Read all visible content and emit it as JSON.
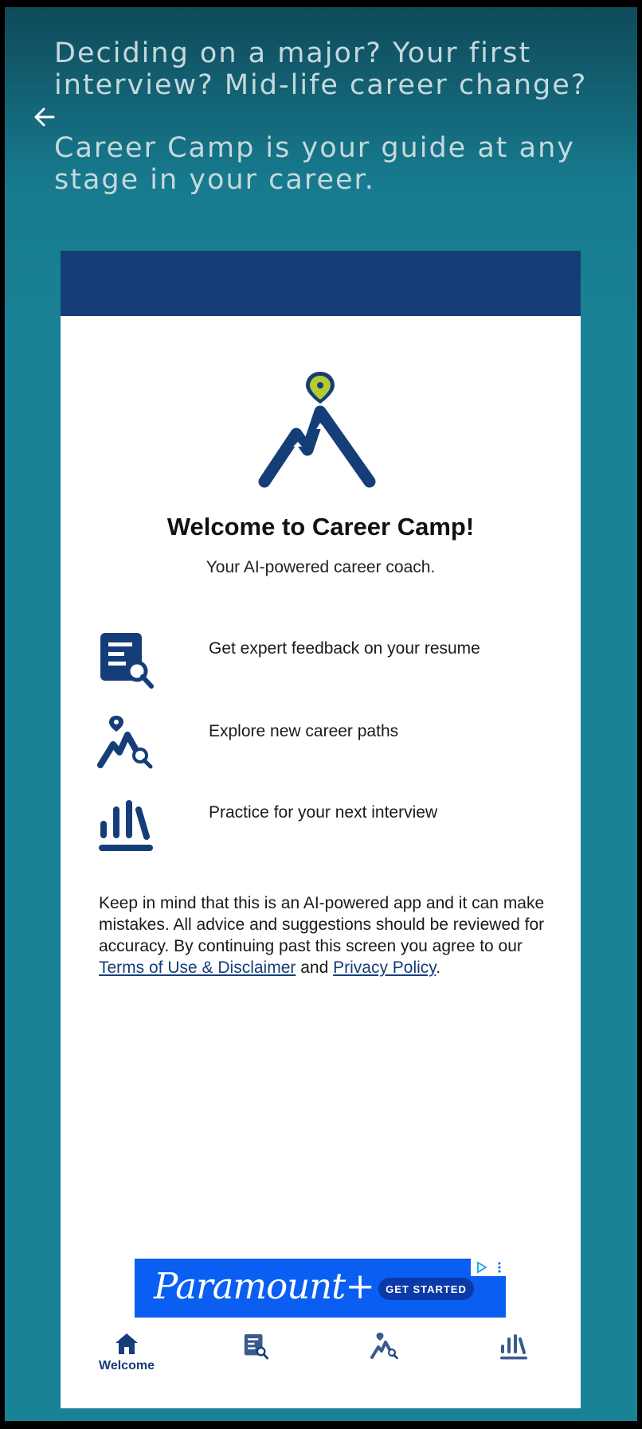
{
  "promo": {
    "line1": "Deciding on a major?  Your first interview? Mid-life career change?",
    "line2": "Career Camp is your guide at any stage in your career."
  },
  "welcome": {
    "title": "Welcome to Career Camp!",
    "subtitle": "Your AI-powered career coach."
  },
  "features": [
    {
      "icon": "resume-icon",
      "label": "Get expert feedback on your resume"
    },
    {
      "icon": "career-paths-icon",
      "label": "Explore new career paths"
    },
    {
      "icon": "interview-icon",
      "label": "Practice for your next interview"
    }
  ],
  "disclaimer": {
    "text": "Keep in mind that this is an AI-powered app and it can make mistakes. All advice and suggestions should be reviewed for accuracy. By continuing past this screen you agree to our ",
    "terms_link": "Terms of Use & Disclaimer",
    "and": " and ",
    "privacy_link": "Privacy Policy",
    "end": "."
  },
  "ad": {
    "brand": "Paramount+",
    "cta": "GET STARTED"
  },
  "nav": {
    "items": [
      {
        "icon": "home-icon",
        "label": "Welcome",
        "active": true
      },
      {
        "icon": "resume-icon",
        "label": ""
      },
      {
        "icon": "career-paths-icon",
        "label": ""
      },
      {
        "icon": "interview-icon",
        "label": ""
      }
    ]
  },
  "colors": {
    "brand_navy": "#153e78",
    "accent_lime": "#b5cc2e",
    "background_teal": "#1a8296"
  }
}
